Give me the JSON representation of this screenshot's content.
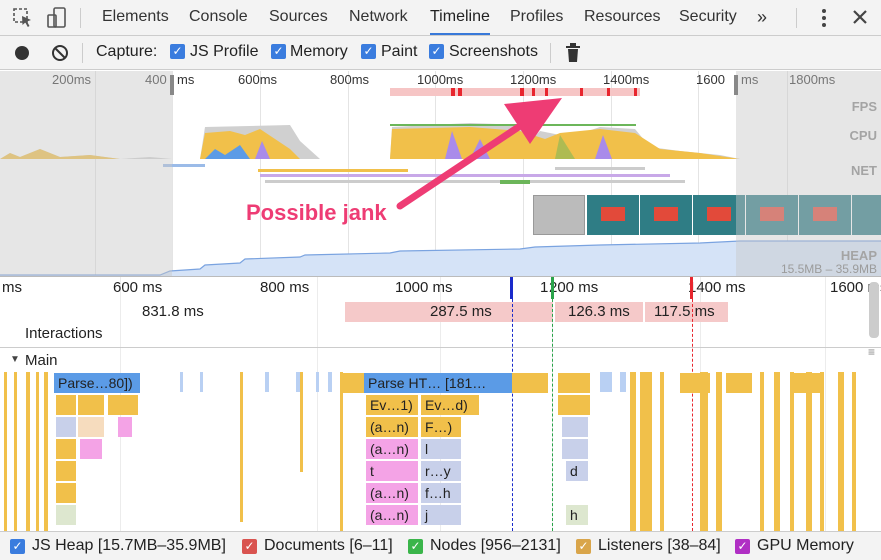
{
  "tabs": [
    {
      "label": "Elements",
      "active": false
    },
    {
      "label": "Console",
      "active": false
    },
    {
      "label": "Sources",
      "active": false
    },
    {
      "label": "Network",
      "active": false
    },
    {
      "label": "Timeline",
      "active": true
    },
    {
      "label": "Profiles",
      "active": false
    },
    {
      "label": "Resources",
      "active": false
    },
    {
      "label": "Security",
      "active": false
    }
  ],
  "more_tabs": "»",
  "capture": {
    "label": "Capture:",
    "options": [
      {
        "label": "JS Profile",
        "checked": true
      },
      {
        "label": "Memory",
        "checked": true
      },
      {
        "label": "Paint",
        "checked": true
      },
      {
        "label": "Screenshots",
        "checked": true
      }
    ]
  },
  "overview": {
    "ticks": [
      "200ms",
      "400",
      "ms",
      "600ms",
      "800ms",
      "1000ms",
      "1200ms",
      "1400ms",
      "1600",
      "ms",
      "1800ms"
    ],
    "lanes": {
      "fps": "FPS",
      "cpu": "CPU",
      "net": "NET",
      "heap": "HEAP"
    },
    "heap_range": "15.5MB – 35.9MB"
  },
  "annotation": "Possible jank",
  "flamechart": {
    "ticks": [
      "ms",
      "600 ms",
      "800 ms",
      "1000 ms",
      "1",
      "200 ms",
      "1400 ms",
      "1600 ms"
    ],
    "interactions_label": "Interactions",
    "interaction_bars": [
      {
        "label": "831.8 ms"
      },
      {
        "label": "287.5 ms"
      },
      {
        "label": "126.3 ms"
      },
      {
        "label": "117.5 ms"
      }
    ],
    "main_label": "Main",
    "blocks": [
      "Parse…80])",
      "Parse HT… [181…",
      "Ev…1)",
      "Ev…d)",
      "(a…n)",
      "F…)",
      "(a…n)",
      "l",
      "t",
      "r…y",
      "d",
      "(a…n)",
      "f…h",
      "(a…n)",
      "j",
      "h"
    ]
  },
  "legend": [
    {
      "label": "JS Heap [15.7MB–35.9MB]",
      "color": "#3a7cde"
    },
    {
      "label": "Documents [6–11]",
      "color": "#d9534f"
    },
    {
      "label": "Nodes [956–2131]",
      "color": "#3ab54a"
    },
    {
      "label": "Listeners [38–84]",
      "color": "#d9a54a"
    },
    {
      "label": "GPU Memory",
      "color": "#b02fc4"
    }
  ],
  "colors": {
    "accent": "#3879d9",
    "jank_red": "#e8262e",
    "scripting": "#f1c04a",
    "rendering": "#a98bea",
    "painting": "#6cb65a",
    "parsing": "#5b9be6",
    "callout": "#ee3c74"
  }
}
